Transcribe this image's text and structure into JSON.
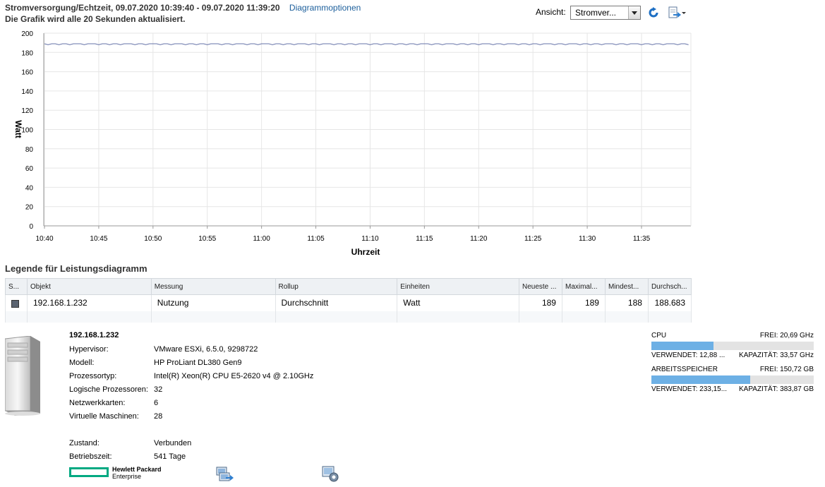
{
  "header": {
    "title_prefix": "Stromversorgung/Echtzeit, 09.07.2020 10:39:40 - 09.07.2020 ",
    "title_time_bold": "11:39:20",
    "chart_options_link": "Diagrammoptionen",
    "subtitle": "Die Grafik wird alle 20 Sekunden aktualisiert.",
    "view_label": "Ansicht:",
    "view_selected": "Stromver...",
    "icons": [
      "refresh-icon",
      "export-icon"
    ]
  },
  "chart_data": {
    "type": "line",
    "ylabel": "Watt",
    "xlabel": "Uhrzeit",
    "ylim": [
      0,
      200
    ],
    "yticks": [
      0,
      20,
      40,
      60,
      80,
      100,
      120,
      140,
      160,
      180,
      200
    ],
    "xticks": [
      "10:40",
      "10:45",
      "10:50",
      "10:55",
      "11:00",
      "11:05",
      "11:10",
      "11:15",
      "11:20",
      "11:25",
      "11:30",
      "11:35"
    ],
    "grid": true,
    "series": [
      {
        "name": "192.168.1.232",
        "color": "#6673a8",
        "start_minute": 0,
        "step_minutes": 0.3333,
        "values": [
          189,
          188,
          189,
          189,
          188,
          189,
          189,
          188,
          189,
          189,
          189,
          188,
          189,
          189,
          189,
          188,
          189,
          189,
          188,
          189,
          189,
          188,
          189,
          189,
          189,
          188,
          189,
          189,
          188,
          189,
          189,
          189,
          188,
          189,
          189,
          188,
          189,
          189,
          189,
          188,
          189,
          189,
          188,
          189,
          189,
          188,
          189,
          189,
          189,
          188,
          189,
          189,
          188,
          189,
          189,
          189,
          188,
          189,
          189,
          188,
          189,
          189,
          189,
          188,
          189,
          189,
          188,
          189,
          189,
          188,
          189,
          189,
          189,
          188,
          189,
          189,
          188,
          189,
          189,
          189,
          188,
          189,
          189,
          188,
          189,
          189,
          188,
          189,
          189,
          189,
          188,
          189,
          189,
          188,
          189,
          189,
          189,
          188,
          189,
          189,
          188,
          189,
          189,
          188,
          189,
          189,
          189,
          188,
          189,
          189,
          188,
          189,
          189,
          189,
          188,
          189,
          189,
          188,
          189,
          189,
          188,
          189,
          189,
          189,
          188,
          189,
          189,
          188,
          189,
          189,
          189,
          188,
          189,
          189,
          188,
          189,
          189,
          188,
          189,
          189,
          189,
          188,
          189,
          189,
          188,
          189,
          189,
          189,
          188,
          189,
          189,
          188,
          189,
          189,
          188,
          189,
          189,
          189,
          188,
          189,
          189,
          188,
          189,
          189,
          189,
          188,
          189,
          189,
          188,
          189,
          189,
          188,
          189,
          189,
          189,
          188,
          189,
          189,
          188
        ]
      }
    ]
  },
  "legend": {
    "title": "Legende für Leistungsdiagramm",
    "columns": [
      "S...",
      "Objekt",
      "Messung",
      "Rollup",
      "Einheiten",
      "Neueste ...",
      "Maximal...",
      "Mindest...",
      "Durchsch..."
    ],
    "rows": [
      {
        "object": "192.168.1.232",
        "measure": "Nutzung",
        "rollup": "Durchschnitt",
        "units": "Watt",
        "latest": "189",
        "max": "189",
        "min": "188",
        "avg": "188.683"
      }
    ]
  },
  "host": {
    "name": "192.168.1.232",
    "fields": [
      {
        "label": "Hypervisor:",
        "value": "VMware ESXi, 6.5.0, 9298722"
      },
      {
        "label": "Modell:",
        "value": "HP ProLiant DL380 Gen9"
      },
      {
        "label": "Prozessortyp:",
        "value": "Intel(R) Xeon(R) CPU E5-2620 v4 @ 2.10GHz"
      },
      {
        "label": "Logische Prozessoren:",
        "value": "32"
      },
      {
        "label": "Netzwerkkarten:",
        "value": "6"
      },
      {
        "label": "Virtuelle Maschinen:",
        "value": "28"
      }
    ],
    "state_label": "Zustand:",
    "state_value": "Verbunden",
    "uptime_label": "Betriebszeit:",
    "uptime_value": "541 Tage",
    "logo_line1": "Hewlett Packard",
    "logo_line2": "Enterprise"
  },
  "resources": [
    {
      "name": "CPU",
      "free": "FREI: 20,69 GHz",
      "used": "VERWENDET: 12,88 ...",
      "capacity": "KAPAZITÄT: 33,57 GHz",
      "used_fraction": 0.384
    },
    {
      "name": "ARBEITSSPEICHER",
      "free": "FREI: 150,72 GB",
      "used": "VERWENDET: 233,15...",
      "capacity": "KAPAZITÄT: 383,87 GB",
      "used_fraction": 0.607
    }
  ]
}
